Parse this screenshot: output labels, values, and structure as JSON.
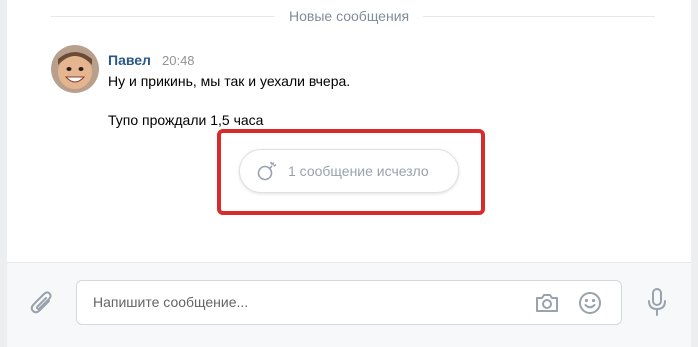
{
  "separator": {
    "label": "Новые сообщения"
  },
  "message": {
    "author": "Павел",
    "time": "20:48",
    "lines": [
      "Ну и прикинь, мы так и уехали вчера.",
      "Тупо прождали 1,5 часа"
    ]
  },
  "vanished": {
    "label": "1 сообщение исчезло"
  },
  "composer": {
    "placeholder": "Напишите сообщение..."
  },
  "colors": {
    "accent": "#2a5885",
    "highlight": "#d92b2b",
    "muted": "#818c99"
  },
  "icons": {
    "attach": "paperclip-icon",
    "camera": "camera-icon",
    "emoji": "smile-icon",
    "mic": "microphone-icon",
    "bomb": "bomb-icon"
  }
}
